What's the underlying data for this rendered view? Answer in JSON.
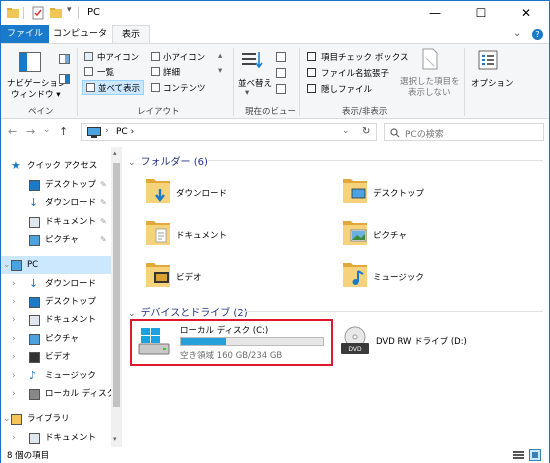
{
  "window": {
    "title": "PC"
  },
  "quick_access": {
    "icons": [
      "properties-icon",
      "new-folder-icon",
      "customize-dropdown-icon"
    ]
  },
  "window_controls": {
    "minimize": "—",
    "maximize": "☐",
    "close": "✕"
  },
  "ribbon_tabs": {
    "file": "ファイル",
    "computer": "コンピューター",
    "view": "表示"
  },
  "ribbon_extra": {
    "collapse": "⌄",
    "help": "?"
  },
  "ribbon": {
    "pane": {
      "nav_pane_line1": "ナビゲーション",
      "nav_pane_line2": "ウィンドウ ▾",
      "group": "ペイン"
    },
    "layout": {
      "medium_icons": "中アイコン",
      "small_icons": "小アイコン",
      "list": "一覧",
      "details": "詳細",
      "tiles": "並べて表示",
      "content": "コンテンツ",
      "group": "レイアウト"
    },
    "current_view": {
      "sort": "並べ替え",
      "group": "現在のビュー"
    },
    "show_hide": {
      "item_checkbox": "項目チェック ボックス",
      "file_extensions": "ファイル名拡張子",
      "hidden_files": "隠しファイル",
      "hide_selected_line1": "選択した項目を",
      "hide_selected_line2": "表示しない",
      "group": "表示/非表示"
    },
    "options": {
      "label": "オプション"
    }
  },
  "nav": {
    "back": "←",
    "forward": "→",
    "recent": "⌄",
    "up": "↑",
    "refresh": "↻"
  },
  "address": {
    "path": "PC  ›",
    "dropdown": "⌄"
  },
  "search": {
    "placeholder": "PCの検索"
  },
  "navpane": {
    "items": [
      {
        "label": "クイック アクセス",
        "icon": "star-icon"
      },
      {
        "label": "デスクトップ",
        "icon": "desktop-icon",
        "pinned": true
      },
      {
        "label": "ダウンロード",
        "icon": "download-icon",
        "pinned": true
      },
      {
        "label": "ドキュメント",
        "icon": "document-icon",
        "pinned": true
      },
      {
        "label": "ピクチャ",
        "icon": "picture-icon",
        "pinned": true
      },
      {
        "label": "PC",
        "icon": "pc-icon",
        "selected": true
      },
      {
        "label": "ダウンロード",
        "icon": "download-icon"
      },
      {
        "label": "デスクトップ",
        "icon": "desktop-icon"
      },
      {
        "label": "ドキュメント",
        "icon": "document-icon"
      },
      {
        "label": "ピクチャ",
        "icon": "picture-icon"
      },
      {
        "label": "ビデオ",
        "icon": "video-icon"
      },
      {
        "label": "ミュージック",
        "icon": "music-icon"
      },
      {
        "label": "ローカル ディスク (C",
        "icon": "drive-icon"
      },
      {
        "label": "ライブラリ",
        "icon": "library-icon"
      },
      {
        "label": "ドキュメント",
        "icon": "document-icon"
      }
    ]
  },
  "content": {
    "folders_header": "フォルダー (6)",
    "folders": [
      {
        "label": "ダウンロード",
        "icon": "download-folder-icon"
      },
      {
        "label": "デスクトップ",
        "icon": "desktop-folder-icon"
      },
      {
        "label": "ドキュメント",
        "icon": "documents-folder-icon"
      },
      {
        "label": "ピクチャ",
        "icon": "pictures-folder-icon"
      },
      {
        "label": "ビデオ",
        "icon": "videos-folder-icon"
      },
      {
        "label": "ミュージック",
        "icon": "music-folder-icon"
      }
    ],
    "drives_header": "デバイスとドライブ (2)",
    "drives": [
      {
        "label": "ローカル ディスク (C:)",
        "space": "空き領域 160 GB/234 GB",
        "used_fraction": 0.316
      },
      {
        "label": "DVD RW ドライブ (D:)"
      }
    ]
  },
  "status": {
    "text": "8 個の項目"
  },
  "colors": {
    "accent": "#1979ca",
    "selection": "#cce8ff",
    "highlight_box": "#e0182d",
    "drive_bar": "#26a0da",
    "folder": "#f0c757"
  }
}
